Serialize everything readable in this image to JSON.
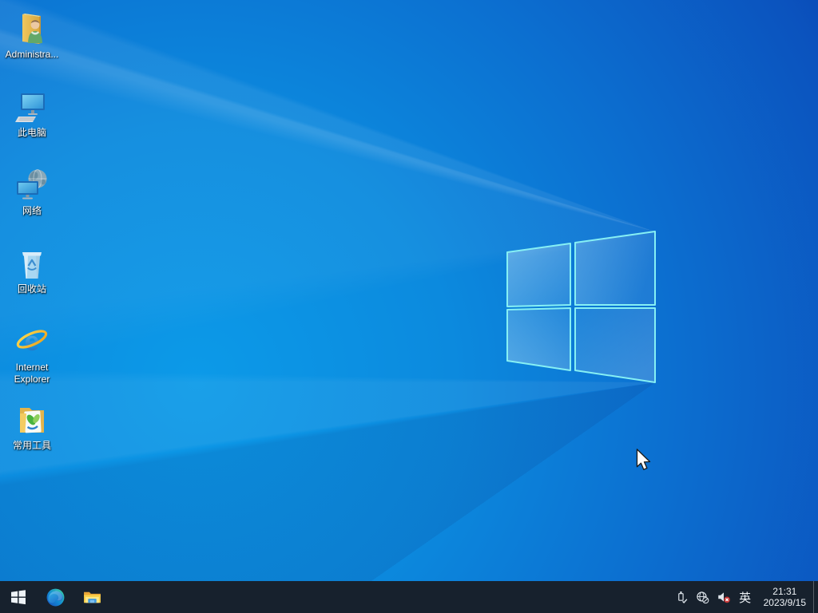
{
  "desktop": {
    "icons": [
      {
        "label": "Administra..."
      },
      {
        "label": "此电脑"
      },
      {
        "label": "网络"
      },
      {
        "label": "回收站"
      },
      {
        "label": "Internet Explorer"
      },
      {
        "label": "常用工具"
      }
    ],
    "icon_glyphs": [
      "user-folder-icon",
      "this-pc-icon",
      "network-globe-icon",
      "recycle-bin-icon",
      "internet-explorer-icon",
      "tools-folder-icon"
    ],
    "wallpaper": "windows-10-light-rays-logo"
  },
  "taskbar": {
    "button_glyphs": [
      "start-icon",
      "edge-icon",
      "file-explorer-icon"
    ],
    "tray": {
      "icon_glyphs": [
        "usb-safe-remove-icon",
        "network-offline-icon",
        "volume-muted-icon"
      ],
      "ime_label": "英",
      "time": "21:31",
      "date": "2023/9/15"
    }
  },
  "colors": {
    "taskbar_bg": "#17212d",
    "wallpaper_bright": "#0c9ae8",
    "wallpaper_dark": "#0a4cb8",
    "logo_outline": "#86f0f4",
    "volume_mute_badge": "#c63535",
    "folder_yellow": "#fbd14b"
  }
}
